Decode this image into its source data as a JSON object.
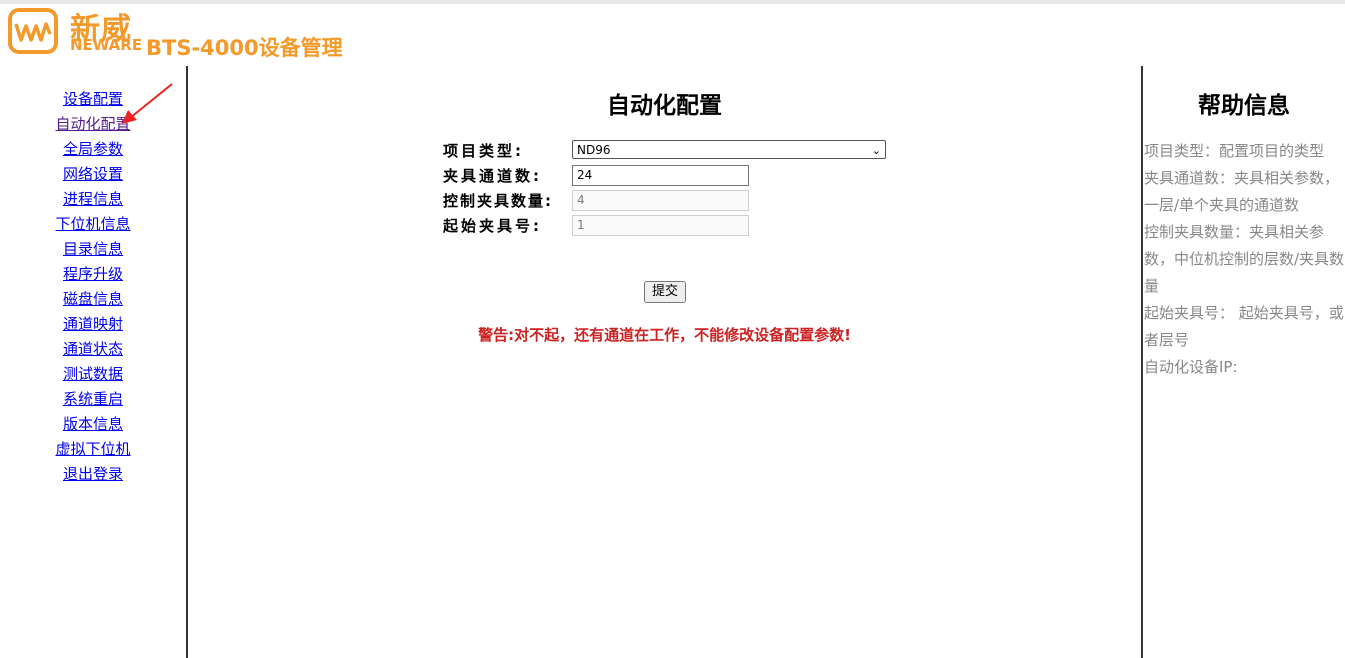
{
  "brand": {
    "name_cn": "新威",
    "name_en": "NEWARE",
    "title": "BTS-4000设备管理",
    "color": "#f39a2b"
  },
  "sidebar": {
    "items": [
      {
        "label": "设备配置"
      },
      {
        "label": "自动化配置"
      },
      {
        "label": "全局参数"
      },
      {
        "label": "网络设置"
      },
      {
        "label": "进程信息"
      },
      {
        "label": "下位机信息"
      },
      {
        "label": "目录信息"
      },
      {
        "label": "程序升级"
      },
      {
        "label": "磁盘信息"
      },
      {
        "label": "通道映射"
      },
      {
        "label": "通道状态"
      },
      {
        "label": "测试数据"
      },
      {
        "label": "系统重启"
      },
      {
        "label": "版本信息"
      },
      {
        "label": "虚拟下位机"
      },
      {
        "label": "退出登录"
      }
    ],
    "link_color": "#0000ee",
    "visited_color": "#551a8b"
  },
  "annotation": {
    "arrow_color": "#ee2222"
  },
  "main": {
    "title": "自动化配置",
    "fields": {
      "project_type": {
        "label": "项目类型:",
        "value": "ND96"
      },
      "fixture_channels": {
        "label": "夹具通道数:",
        "value": "24"
      },
      "control_fixture_count": {
        "label": "控制夹具数量:",
        "value": "4"
      },
      "start_fixture_no": {
        "label": "起始夹具号:",
        "value": "1"
      }
    },
    "submit_label": "提交",
    "warning": "警告:对不起，还有通道在工作，不能修改设备配置参数!",
    "warning_color": "#cc2222"
  },
  "help": {
    "title": "帮助信息",
    "lines": [
      "项目类型：配置项目的类型",
      "夹具通道数：夹具相关参数，一层/单个夹具的通道数",
      "控制夹具数量：夹具相关参数，中位机控制的层数/夹具数量",
      "起始夹具号： 起始夹具号，或者层号",
      "自动化设备IP:"
    ]
  }
}
